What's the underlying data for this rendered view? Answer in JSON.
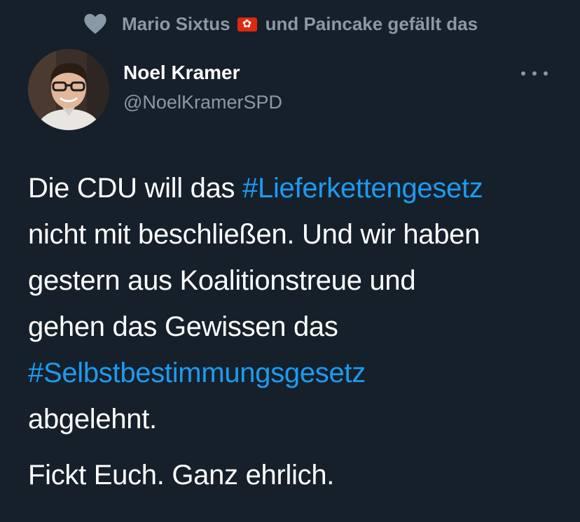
{
  "social_context": {
    "icon": "heart-icon",
    "user1": "Mario Sixtus",
    "flag_icon": "hong-kong-flag-icon",
    "rest": "und Paincake gefällt das"
  },
  "author": {
    "name": "Noel Kramer",
    "handle": "@NoelKramerSPD"
  },
  "more_icon": "more-options-icon",
  "tweet": {
    "line1_pre": "Die CDU will das ",
    "hashtag1": "#Lieferkettengesetz",
    "line2": "nicht mit beschließen. Und wir haben",
    "line3": "gestern aus Koalitionstreue und",
    "line4": "gehen das Gewissen das",
    "hashtag2": "#Selbstbestimmungsgesetz",
    "line6": "abgelehnt.",
    "paragraph2": "Fickt Euch. Ganz ehrlich."
  },
  "colors": {
    "background": "#15202b",
    "text": "#ffffff",
    "secondary": "#8b98a5",
    "link": "#1d9bf0"
  }
}
